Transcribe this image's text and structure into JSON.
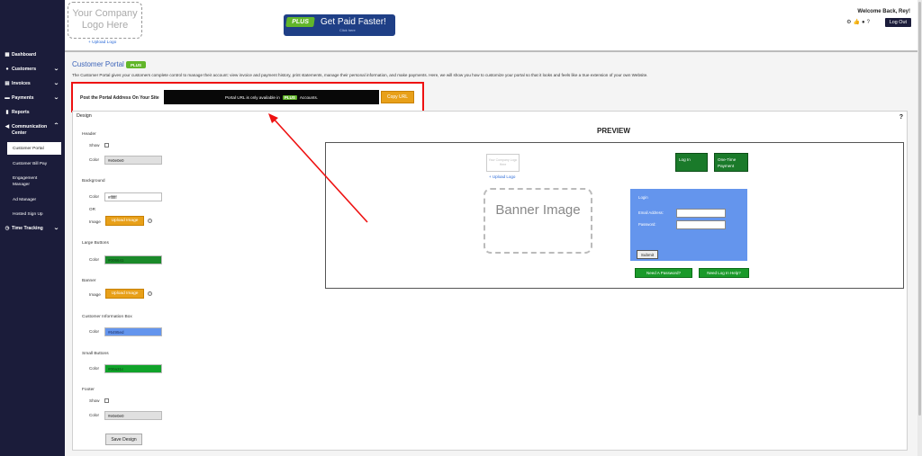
{
  "sidebar": {
    "items": [
      {
        "label": "Dashboard",
        "icon": "grid-icon",
        "chevron": false
      },
      {
        "label": "Customers",
        "icon": "user-icon",
        "chevron": true
      },
      {
        "label": "Invoices",
        "icon": "doc-icon",
        "chevron": true
      },
      {
        "label": "Payments",
        "icon": "card-icon",
        "chevron": true
      },
      {
        "label": "Reports",
        "icon": "bar-chart-icon",
        "chevron": false
      },
      {
        "label": "Communication Center",
        "icon": "megaphone-icon",
        "chevron": true,
        "expanded": true
      },
      {
        "label": "Time Tracking",
        "icon": "clock-icon",
        "chevron": true
      }
    ],
    "subitems": [
      "Customer Portal",
      "Customer Bill Pay",
      "Engagement Manager",
      "Ad Manager",
      "Hosted Sign Up"
    ]
  },
  "header": {
    "logo_text": "Your Company Logo Here",
    "upload_logo": "+ Upload Logo",
    "plus_tag": "PLUS",
    "plus_text": "Get Paid Faster!",
    "plus_sub": "Click here",
    "welcome": "Welcome Back, Rey!",
    "logout": "Log Out"
  },
  "page": {
    "title": "Customer Portal",
    "title_badge": "PLUS",
    "intro": "The Customer Portal gives your customers complete control to manage their account: view invoice and payment history, print statements, manage their personal information, and make payments. Here, we will show you how to customize your portal so that it looks and feels like a true extension of your own Website.",
    "portal_label": "Post the Portal Address On Your Site",
    "portal_url_before": "Portal URL is only available in",
    "portal_url_tag": "PLUS",
    "portal_url_after": "Accounts.",
    "copy_url": "Copy URL"
  },
  "design": {
    "label": "Design",
    "help": "?",
    "header_section": "Header",
    "show_label": "Show",
    "color_label": "Color",
    "header_color": "#e0e0e0",
    "background_section": "Background",
    "background_color": "#ffffff",
    "or_label": "OR",
    "image_label": "Image",
    "upload_image": "Upload Image",
    "large_buttons_section": "Large Buttons",
    "large_buttons_color": "#006641",
    "banner_section": "Banner",
    "customer_info_section": "Customer Information Box",
    "customer_info_color": "#6495ed",
    "small_buttons_section": "Small Buttons",
    "small_buttons_color": "#00a31c",
    "footer_section": "Footer",
    "footer_color": "#e0e0e0",
    "save": "Save Design"
  },
  "preview": {
    "title": "PREVIEW",
    "logo_text": "Your Company Logo Here",
    "upload_logo": "+ Upload Logo",
    "login": "Log In",
    "one_time": "One-Time Payment",
    "banner": "Banner Image",
    "login_box_title": "Login",
    "email_label": "Email Address:",
    "password_label": "Password:",
    "submit": "Submit",
    "need_password": "Need A Password?",
    "need_help": "Need Log In Help?"
  },
  "colors": {
    "sidebar": "#1b1c3a",
    "accent_blue": "#3a62b8",
    "plus_green": "#62b62a",
    "orange": "#e8a019",
    "highlight_red": "#e11111",
    "green_button": "#1a7a2a",
    "login_box": "#6495ed"
  }
}
